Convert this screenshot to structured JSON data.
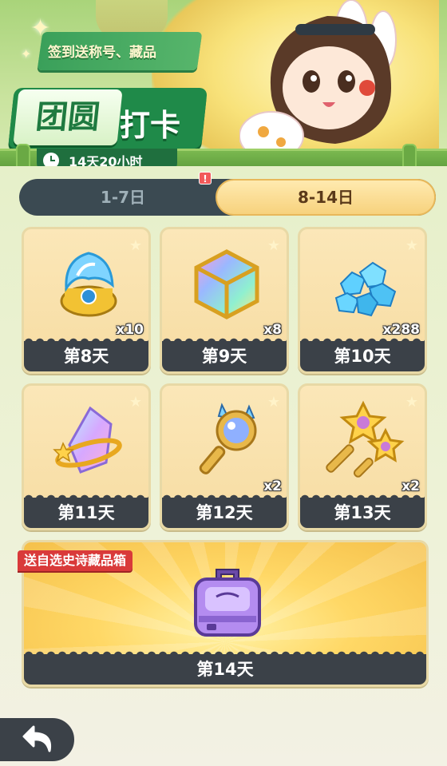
{
  "header": {
    "promo_text": "签到送称号、藏品",
    "title_main": "团圆",
    "title_sub": "打卡",
    "countdown": "14天20小时"
  },
  "tabs": [
    {
      "label": "1-7日",
      "active": false
    },
    {
      "label": "8-14日",
      "active": true
    }
  ],
  "tab_alert_badge": "!",
  "rewards": [
    {
      "day_label": "第8天",
      "quantity": "x10",
      "icon": "blue-flame-token-icon"
    },
    {
      "day_label": "第9天",
      "quantity": "x8",
      "icon": "rainbow-cube-icon"
    },
    {
      "day_label": "第10天",
      "quantity": "x288",
      "icon": "blue-gems-icon"
    },
    {
      "day_label": "第11天",
      "quantity": "",
      "icon": "crystal-ring-icon"
    },
    {
      "day_label": "第12天",
      "quantity": "x2",
      "icon": "magic-mirror-key-icon"
    },
    {
      "day_label": "第13天",
      "quantity": "x2",
      "icon": "golden-star-keys-icon"
    }
  ],
  "final_reward": {
    "ribbon": "送自选史诗藏品箱",
    "day_label": "第14天",
    "icon": "purple-chest-icon"
  },
  "colors": {
    "accent_green": "#1f8a49",
    "tab_active": "#f7d27d",
    "card_footer": "#3b4148",
    "ribbon_red": "#d93a3a"
  },
  "back_button_icon": "back-arrow-icon"
}
